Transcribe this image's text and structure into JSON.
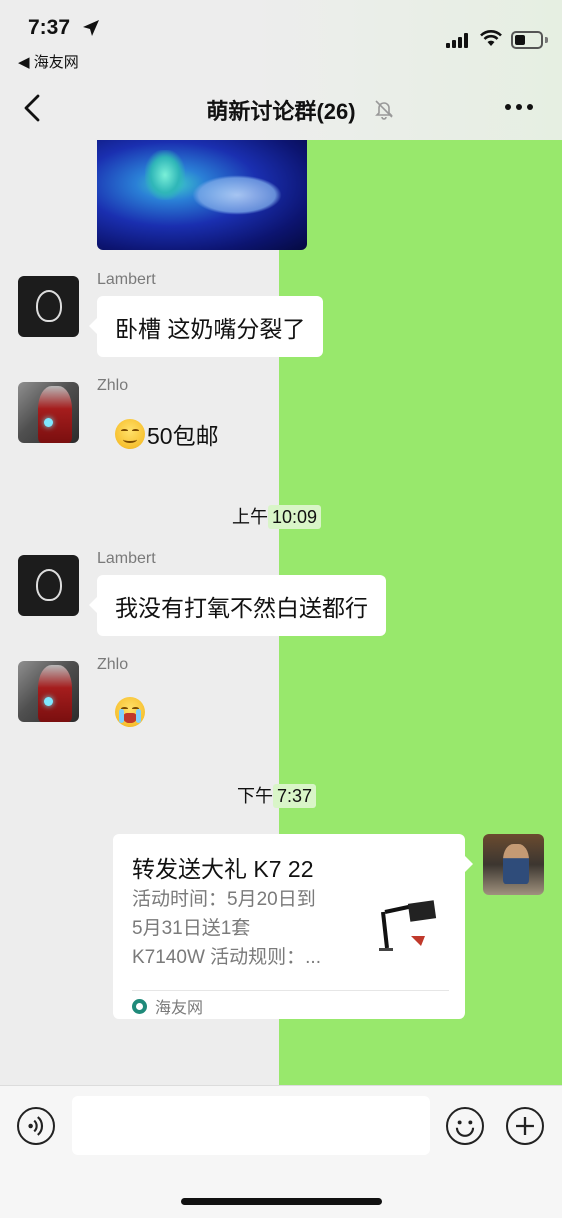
{
  "status_bar": {
    "time": "7:37",
    "back_app": "◀ 海友网"
  },
  "header": {
    "title": "萌新讨论群",
    "member_count": "(26)"
  },
  "messages": [
    {
      "sender": "Lambert",
      "text": "卧槽 这奶嘴分裂了"
    },
    {
      "sender": "Zhlo",
      "text": "50包邮"
    },
    {
      "sender": "Lambert",
      "text": "我没有打氧不然白送都行"
    },
    {
      "sender": "Zhlo",
      "text": ""
    }
  ],
  "timestamps": [
    {
      "period": "上午",
      "time": "10:09"
    },
    {
      "period": "下午",
      "time": "7:37"
    }
  ],
  "link_card": {
    "title": "转发送大礼 K7 22",
    "desc_lines": [
      "活动时间：5月20日到",
      "5月31日送1套",
      "K7140W 活动规则：..."
    ],
    "source": "海友网"
  },
  "input": {
    "placeholder": ""
  },
  "icons": {
    "back": "chevron-left-icon",
    "mute": "bell-slash-icon",
    "more": "more-dots-icon",
    "voice": "voice-icon",
    "emoji": "emoji-icon",
    "plus": "plus-icon"
  }
}
